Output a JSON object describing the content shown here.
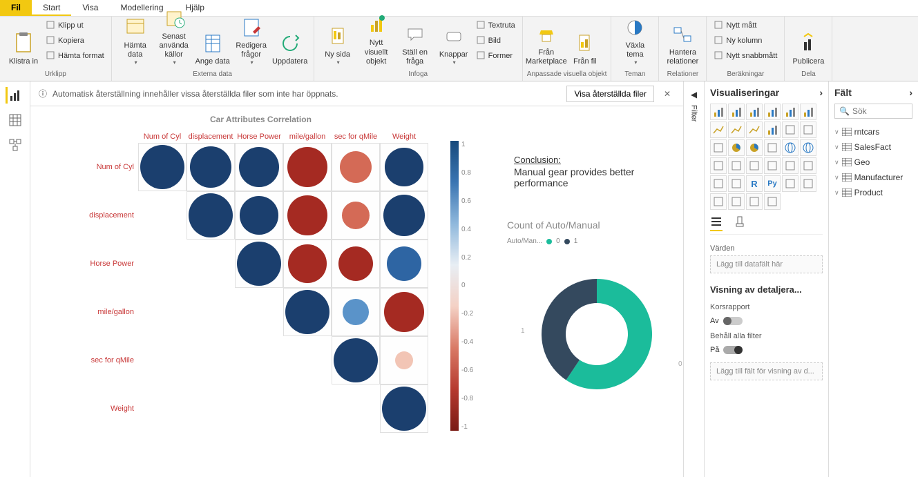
{
  "menubar": {
    "file": "Fil",
    "tabs": [
      "Start",
      "Visa",
      "Modellering",
      "Hjälp"
    ]
  },
  "ribbon": {
    "groups": [
      {
        "label": "Urklipp",
        "items": [
          {
            "type": "large",
            "label": "Klistra in",
            "icon": "clipboard"
          },
          {
            "type": "small-col",
            "items": [
              "Klipp ut",
              "Kopiera",
              "Hämta format"
            ]
          }
        ]
      },
      {
        "label": "Externa data",
        "items": [
          {
            "type": "large",
            "label": "Hämta data",
            "icon": "getdata",
            "drop": true
          },
          {
            "type": "large",
            "label": "Senast använda källor",
            "icon": "recent",
            "drop": true
          },
          {
            "type": "large",
            "label": "Ange data",
            "icon": "enter"
          },
          {
            "type": "large",
            "label": "Redigera frågor",
            "icon": "edit",
            "drop": true
          },
          {
            "type": "large",
            "label": "Uppdatera",
            "icon": "refresh"
          }
        ]
      },
      {
        "label": "Infoga",
        "items": [
          {
            "type": "large",
            "label": "Ny sida",
            "icon": "page",
            "drop": true
          },
          {
            "type": "large",
            "label": "Nytt visuellt objekt",
            "icon": "visual"
          },
          {
            "type": "large",
            "label": "Ställ en fråga",
            "icon": "ask"
          },
          {
            "type": "large",
            "label": "Knappar",
            "icon": "btn",
            "drop": true
          },
          {
            "type": "small-col",
            "items": [
              "Textruta",
              "Bild",
              "Former"
            ]
          }
        ]
      },
      {
        "label": "Anpassade visuella objekt",
        "items": [
          {
            "type": "large",
            "label": "Från Marketplace",
            "icon": "market"
          },
          {
            "type": "large",
            "label": "Från fil",
            "icon": "file"
          }
        ]
      },
      {
        "label": "Teman",
        "items": [
          {
            "type": "large",
            "label": "Växla tema",
            "icon": "theme",
            "drop": true
          }
        ]
      },
      {
        "label": "Relationer",
        "items": [
          {
            "type": "large",
            "label": "Hantera relationer",
            "icon": "rel"
          }
        ]
      },
      {
        "label": "Beräkningar",
        "items": [
          {
            "type": "small-col",
            "items": [
              "Nytt mått",
              "Ny kolumn",
              "Nytt snabbmått"
            ]
          }
        ]
      },
      {
        "label": "Dela",
        "items": [
          {
            "type": "large",
            "label": "Publicera",
            "icon": "publish"
          }
        ]
      }
    ]
  },
  "notification": {
    "message": "Automatisk återställning innehåller vissa återställda filer som inte har öppnats.",
    "button": "Visa återställda filer"
  },
  "correlation": {
    "title": "Car Attributes Correlation",
    "labels": [
      "Num of Cyl",
      "displacement",
      "Horse Power",
      "mile/gallon",
      "sec for qMile",
      "Weight"
    ]
  },
  "colorScale": [
    "1",
    "0.8",
    "0.6",
    "0.4",
    "0.2",
    "0",
    "-0.2",
    "-0.4",
    "-0.6",
    "-0.8",
    "-1"
  ],
  "conclusion": {
    "heading": "Conclusion:",
    "text": "Manual gear provides better performance"
  },
  "donut": {
    "title": "Count of Auto/Manual",
    "legend_label": "Auto/Man...",
    "series": [
      {
        "name": "0",
        "color": "#1bbc9b"
      },
      {
        "name": "1",
        "color": "#34495e"
      }
    ],
    "axis_labels": [
      "1",
      "0"
    ]
  },
  "filterTab": "Filter",
  "vizPanel": {
    "title": "Visualiseringar",
    "valuesLabel": "Värden",
    "valuesWell": "Lägg till datafält här",
    "drillHeader": "Visning av detaljera...",
    "crossReport": "Korsrapport",
    "crossReportState": "Av",
    "keepFilters": "Behåll alla filter",
    "keepFiltersState": "På",
    "drillWell": "Lägg till fält för visning av d..."
  },
  "fieldsPanel": {
    "title": "Fält",
    "searchPlaceholder": "Sök",
    "tables": [
      "rntcars",
      "SalesFact",
      "Geo",
      "Manufacturer",
      "Product"
    ]
  },
  "chart_data": [
    {
      "type": "heatmap",
      "title": "Car Attributes Correlation",
      "categories": [
        "Num of Cyl",
        "displacement",
        "Horse Power",
        "mile/gallon",
        "sec for qMile",
        "Weight"
      ],
      "matrix": [
        [
          1.0,
          0.9,
          0.85,
          -0.85,
          -0.6,
          0.8
        ],
        [
          null,
          1.0,
          0.8,
          -0.85,
          -0.45,
          0.9
        ],
        [
          null,
          null,
          1.0,
          -0.8,
          -0.7,
          0.7
        ],
        [
          null,
          null,
          null,
          1.0,
          0.4,
          -0.85
        ],
        [
          null,
          null,
          null,
          null,
          1.0,
          -0.15
        ],
        [
          null,
          null,
          null,
          null,
          null,
          1.0
        ]
      ],
      "color_range": [
        -1,
        1
      ]
    },
    {
      "type": "pie",
      "title": "Count of Auto/Manual",
      "series": [
        {
          "name": "0",
          "value": 19
        },
        {
          "name": "1",
          "value": 13
        }
      ]
    }
  ]
}
